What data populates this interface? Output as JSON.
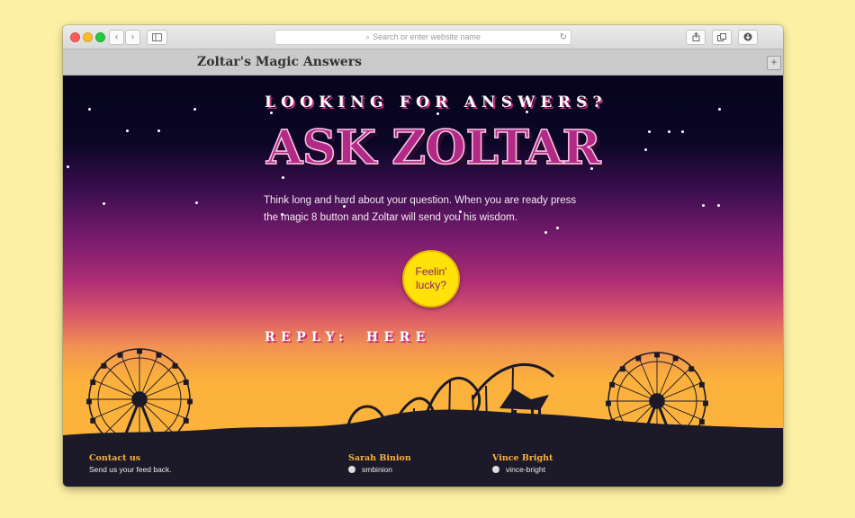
{
  "browser": {
    "search_placeholder": "Search or enter website name",
    "back_glyph": "‹",
    "forward_glyph": "›",
    "icons": [
      "sidebar-icon",
      "share-icon",
      "tabs-icon",
      "downloads-icon",
      "reload-icon",
      "search-icon",
      "new-tab-icon"
    ]
  },
  "tab": {
    "title": "Zoltar's Magic Answers"
  },
  "hero": {
    "subtitle": "LOOKING FOR ANSWERS?",
    "title": "ASK ZOLTAR",
    "intro": "Think long and hard about your question. When you are ready press the magic 8 button and Zoltar will send you his wisdom."
  },
  "button": {
    "line1": "Feelin'",
    "line2": "lucky?"
  },
  "reply": {
    "label": "REPLY:",
    "value": "HERE"
  },
  "footer": {
    "contact": {
      "title": "Contact us",
      "text": "Send us your feed back."
    },
    "author1": {
      "name": "Sarah Binion",
      "handle": "smbinion"
    },
    "author2": {
      "name": "Vince Bright",
      "handle": "vince-bright"
    }
  },
  "colors": {
    "page_bg": "#fdf0a4",
    "accent_pink": "#b32a86",
    "button_yellow": "#ffe20a",
    "footer_title": "#fbb13c"
  }
}
